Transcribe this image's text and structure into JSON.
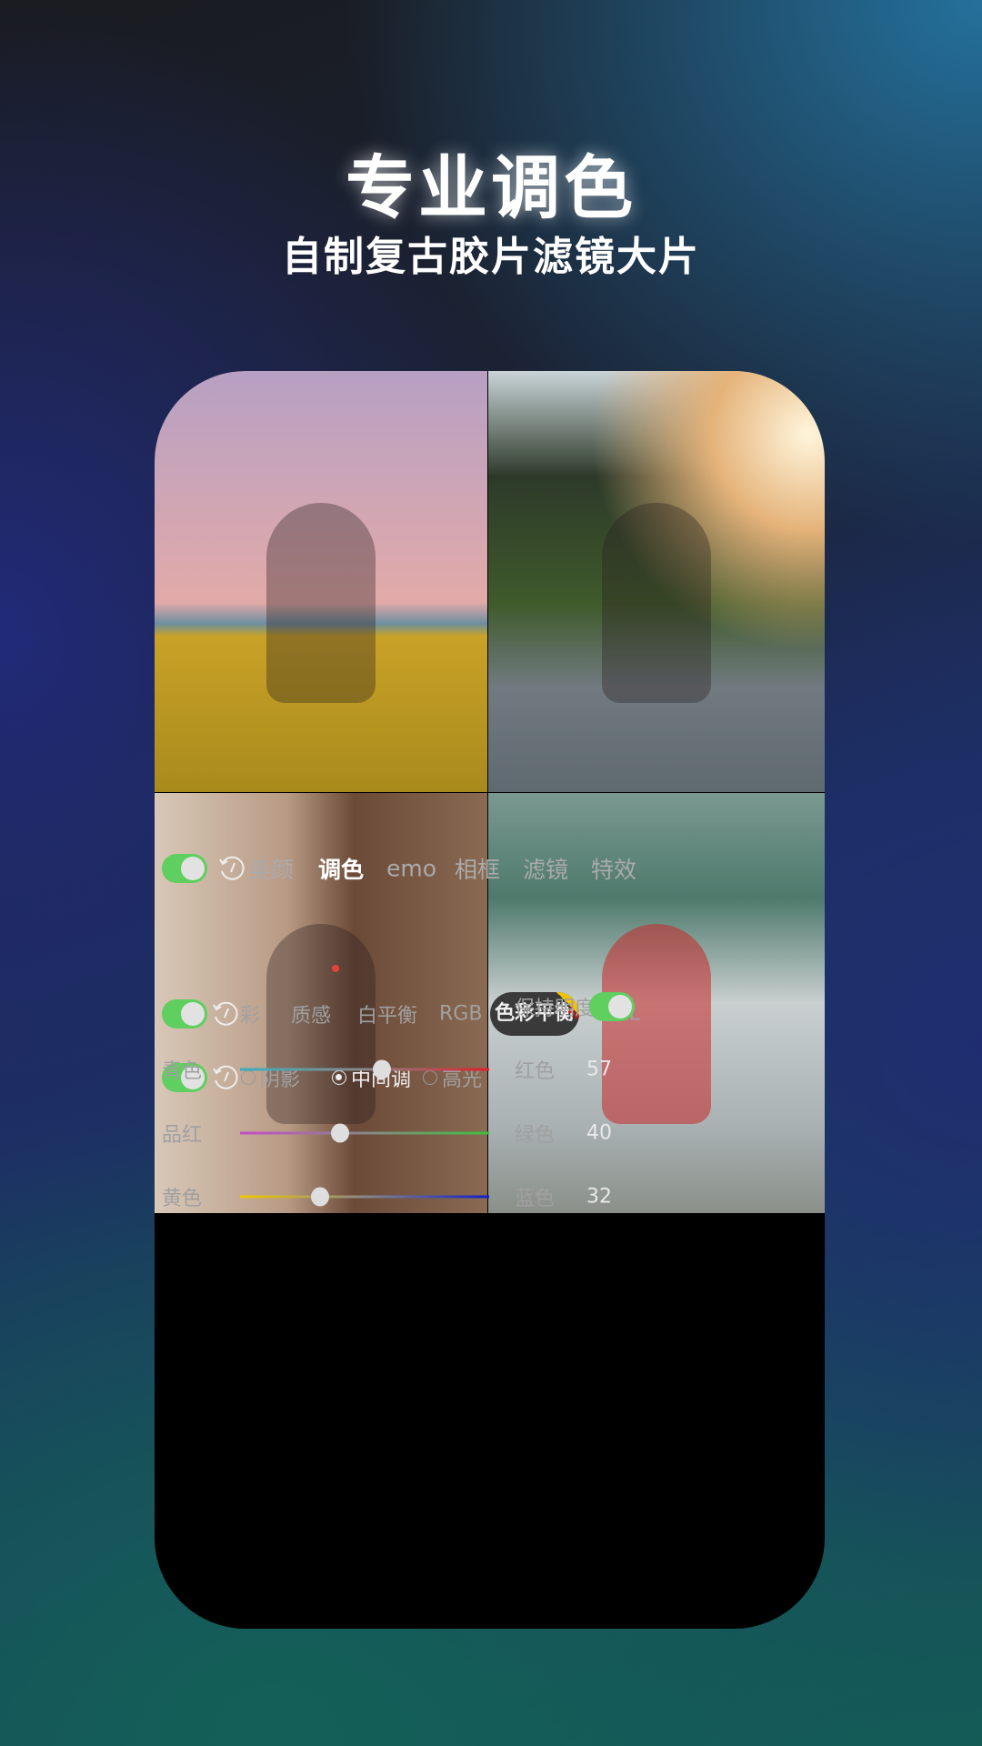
{
  "header": {
    "title": "专业调色",
    "subtitle": "自制复古胶片滤镜大片"
  },
  "tabs": [
    {
      "label": "美颜"
    },
    {
      "label": "调色",
      "active": true
    },
    {
      "label": "emo"
    },
    {
      "label": "相框"
    },
    {
      "label": "滤镜"
    },
    {
      "label": "特效"
    }
  ],
  "subtabs": [
    {
      "label": "彩"
    },
    {
      "label": "质感"
    },
    {
      "label": "白平衡"
    },
    {
      "label": "RGB"
    },
    {
      "label": "色彩平衡",
      "active": true,
      "badge": "VIP"
    },
    {
      "label": "HSL"
    }
  ],
  "tones": {
    "options": [
      {
        "label": "阴影",
        "selected": false
      },
      {
        "label": "中间调",
        "selected": true
      },
      {
        "label": "高光",
        "selected": false
      }
    ],
    "preserve_label": "保持明度",
    "preserve_on": true
  },
  "sliders": [
    {
      "left": "青色",
      "right": "红色",
      "value": "57",
      "fraction": 0.57,
      "colors": [
        "#3aaec0",
        "#e01e2a"
      ]
    },
    {
      "left": "品红",
      "right": "绿色",
      "value": "40",
      "fraction": 0.4,
      "colors": [
        "#c64ccc",
        "#3cc03c"
      ]
    },
    {
      "left": "黄色",
      "right": "蓝色",
      "value": "32",
      "fraction": 0.32,
      "colors": [
        "#f0c800",
        "#1020c8"
      ]
    }
  ],
  "colors": {
    "toggle": "#5fcf5f",
    "active_dot": "#e8403f",
    "vip": "#f2c200"
  }
}
